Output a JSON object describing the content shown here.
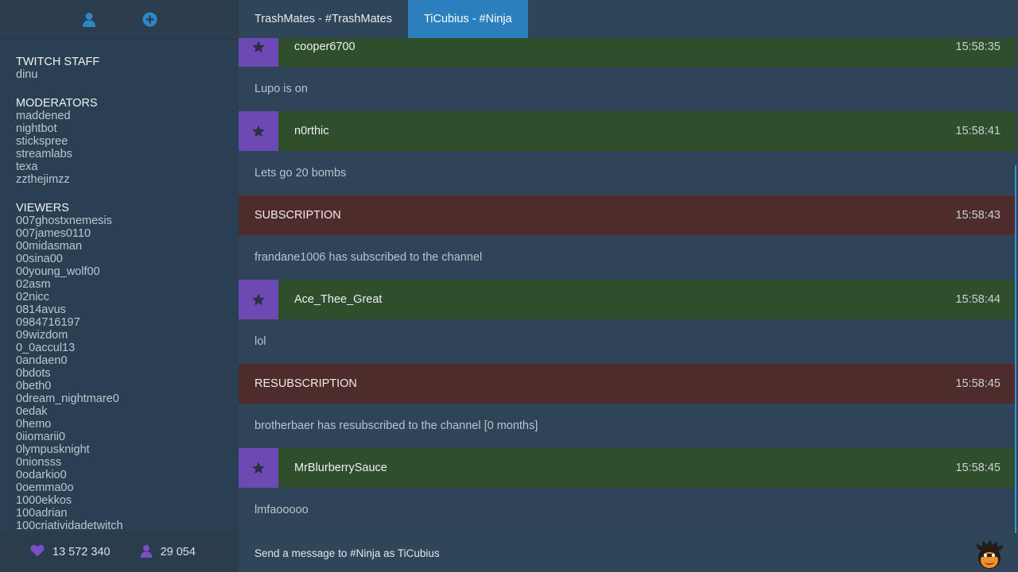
{
  "sidebar": {
    "top_icons": [
      "user-icon",
      "add-circle-icon"
    ],
    "groups": [
      {
        "title": "TWITCH STAFF",
        "names": [
          "dinu"
        ]
      },
      {
        "title": "MODERATORS",
        "names": [
          "maddened",
          "nightbot",
          "stickspree",
          "streamlabs",
          "texa",
          "zzthejimzz"
        ]
      },
      {
        "title": "VIEWERS",
        "names": [
          "007ghostxnemesis",
          "007james0110",
          "00midasman",
          "00sina00",
          "00young_wolf00",
          "02asm",
          "02nicc",
          "0814avus",
          "0984716197",
          "09wizdom",
          "0_0accul13",
          "0andaen0",
          "0bdots",
          "0beth0",
          "0dream_nightmare0",
          "0edak",
          "0hemo",
          "0iiomarii0",
          "0lympusknight",
          "0nionsss",
          "0odarkio0",
          "0oemma0o",
          "1000ekkos",
          "100adrian",
          "100criatividadetwitch"
        ]
      }
    ],
    "stats": {
      "followers": "13 572 340",
      "viewers": "29 054"
    }
  },
  "tabs": [
    {
      "label": "TrashMates - #TrashMates",
      "active": false
    },
    {
      "label": "TiCubius - #Ninja",
      "active": true
    }
  ],
  "messages": [
    {
      "type": "chat",
      "user": "cooper6700",
      "time": "15:58:35",
      "text": "Lupo is on"
    },
    {
      "type": "chat",
      "user": "n0rthic",
      "time": "15:58:41",
      "text": "Lets go 20 bombs"
    },
    {
      "type": "event",
      "title": "SUBSCRIPTION",
      "time": "15:58:43",
      "text": "frandane1006 has subscribed to the channel"
    },
    {
      "type": "chat",
      "user": "Ace_Thee_Great",
      "time": "15:58:44",
      "text": "lol"
    },
    {
      "type": "event",
      "title": "RESUBSCRIPTION",
      "time": "15:58:45",
      "text": "brotherbaer has resubscribed to the channel [0 months]"
    },
    {
      "type": "chat",
      "user": "MrBlurberrySauce",
      "time": "15:58:45",
      "text": "lmfaooooo"
    }
  ],
  "input": {
    "placeholder": "Send a message to #Ninja as TiCubius"
  },
  "colors": {
    "accent": "#2b7fbd",
    "chat_header": "#2f4f2c",
    "event_header": "#4e2c2c",
    "star_bg": "#6d49b4"
  }
}
